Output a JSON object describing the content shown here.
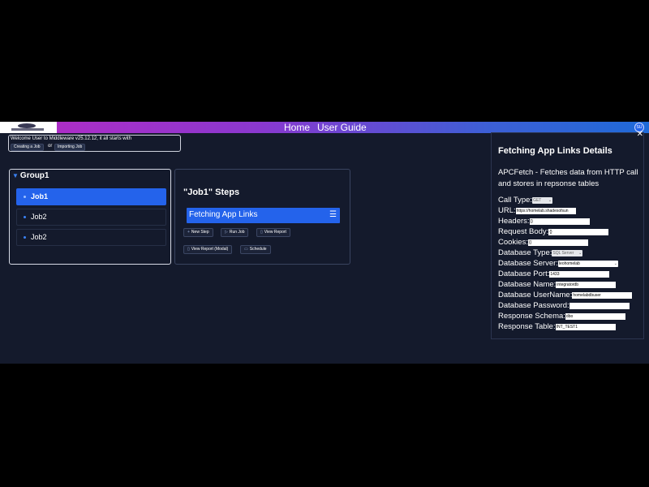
{
  "header": {
    "nav": [
      "Home",
      "User Guide"
    ],
    "avatar": "SU",
    "colors": {
      "gradient_start": "#b52bc4",
      "gradient_end": "#1f6ad8"
    }
  },
  "welcome": {
    "text": "Welcome User to Middleware v25.12.12, it all starts with",
    "create_label": "Creating a Job",
    "or_text": "or",
    "import_label": "Importing Job"
  },
  "group": {
    "title": "Group1",
    "jobs": [
      {
        "label": "Job1",
        "active": true
      },
      {
        "label": "Job2",
        "active": false
      },
      {
        "label": "Job2",
        "active": false
      }
    ]
  },
  "steps": {
    "title": "\"Job1\" Steps",
    "step_label": "Fetching App Links",
    "menu_icon": "hamburger-icon",
    "actions": [
      "New Step",
      "Run Job",
      "View Report",
      "View Report (Modal)",
      "Schedule"
    ]
  },
  "details": {
    "title": "Fetching App Links Details",
    "description": "APCFetch - Fetches data from HTTP call and stores in repsonse tables",
    "fields": {
      "call_type": {
        "label": "Call Type:",
        "value": "GET"
      },
      "url": {
        "label": "URL:",
        "value": "https://homelab.shadesofsun"
      },
      "headers": {
        "label": "Headers:",
        "value": "{}"
      },
      "request_body": {
        "label": "Request Body:",
        "value": "{}"
      },
      "cookies": {
        "label": "Cookies:",
        "value": "{}"
      },
      "database_type": {
        "label": "Database Type:",
        "value": "SQL Server"
      },
      "database_server": {
        "label": "Database Server:",
        "value": "leohomelab"
      },
      "database_port": {
        "label": "Database Port:",
        "value": "1433"
      },
      "database_name": {
        "label": "Database Name:",
        "value": "integratordb"
      },
      "database_username": {
        "label": "Database UserName:",
        "value": "homelabdbuser"
      },
      "database_password": {
        "label": "Database Password:",
        "value": ""
      },
      "response_schema": {
        "label": "Response Schema:",
        "value": "dbo"
      },
      "response_table": {
        "label": "Response Table:",
        "value": "INT_TEST1"
      }
    }
  }
}
